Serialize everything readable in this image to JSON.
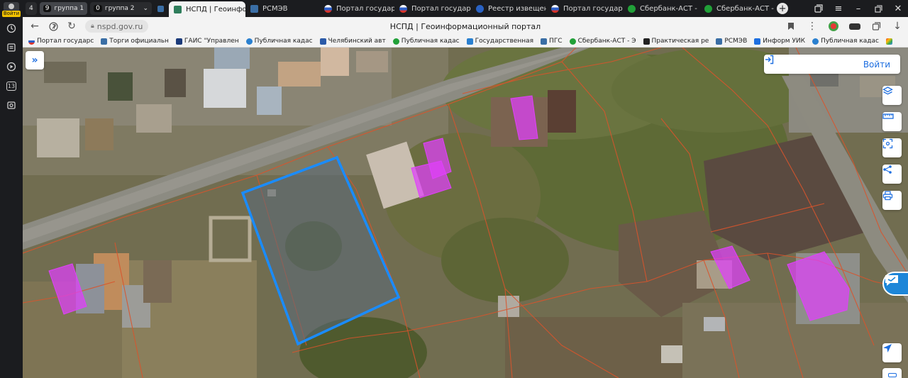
{
  "sidebar": {
    "login_badge": "Войти",
    "counter": "13"
  },
  "tab_groups": [
    {
      "count": "4",
      "label": ""
    },
    {
      "count": "9",
      "label": "группа 1"
    },
    {
      "count": "0",
      "label": "группа 2"
    }
  ],
  "tabs": [
    {
      "label": "НСПД | Геоинфо",
      "active": true,
      "color": "#2e7d5b"
    },
    {
      "label": "РСМЭВ",
      "active": false,
      "color": "#3a6ea5"
    },
    {
      "label": "Портал государств",
      "active": false,
      "color": "#d9534f"
    },
    {
      "label": "Портал государств",
      "active": false,
      "color": "#d9534f"
    },
    {
      "label": "Реестр извещений",
      "active": false,
      "color": "#2962c4"
    },
    {
      "label": "Портал государств",
      "active": false,
      "color": "#d9534f"
    },
    {
      "label": "Сбербанк-АСТ - Эл",
      "active": false,
      "color": "#21a038"
    },
    {
      "label": "Сбербанк-АСТ - Эл",
      "active": false,
      "color": "#21a038"
    }
  ],
  "address": {
    "url": "nspd.gov.ru",
    "title": "НСПД | Геоинформационный портал"
  },
  "bookmarks": [
    {
      "label": "Портал государс",
      "color": "#d9534f"
    },
    {
      "label": "Торги официальн",
      "color": "#3a6ea5"
    },
    {
      "label": "ГАИС \"Управлен",
      "color": "#1b3a7a"
    },
    {
      "label": "Публичная кадас",
      "color": "#2a80d0"
    },
    {
      "label": "Челябинский авт",
      "color": "#2b5aa8"
    },
    {
      "label": "Публичная кадас",
      "color": "#21a038"
    },
    {
      "label": "Государственная",
      "color": "#2a80d0"
    },
    {
      "label": "ПГС",
      "color": "#3a6ea5"
    },
    {
      "label": "Сбербанк-АСТ - Э",
      "color": "#21a038"
    },
    {
      "label": "Практическая ре",
      "color": "#222222"
    },
    {
      "label": "РСМЭВ",
      "color": "#3a6ea5"
    },
    {
      "label": "Информ УИК",
      "color": "#1d6ee0"
    },
    {
      "label": "Публичная кадас",
      "color": "#2a80d0"
    }
  ],
  "map": {
    "login_label": "Войти",
    "colors": {
      "accent": "#1d6ee0",
      "parcel_selected": "#1a8cff",
      "building": "#e040fb",
      "boundary": "#d9542c"
    },
    "tools": [
      "layers-icon",
      "ruler-icon",
      "select-area-icon",
      "share-icon",
      "print-icon",
      "locate-icon"
    ]
  }
}
